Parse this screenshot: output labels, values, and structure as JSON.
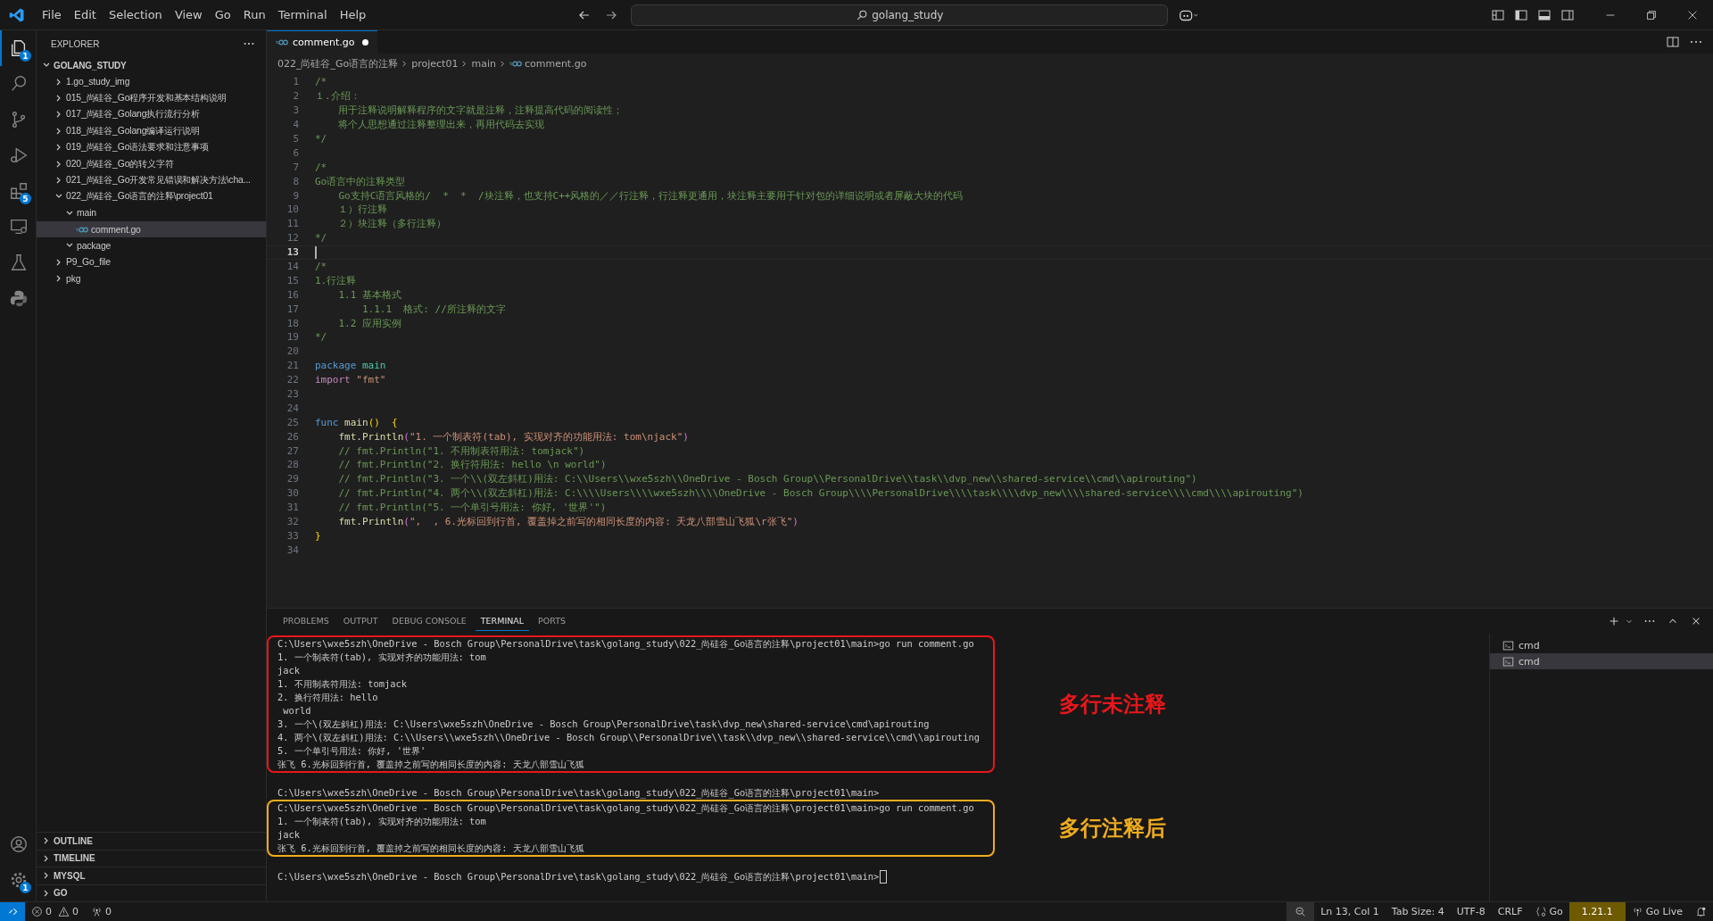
{
  "menu": [
    "File",
    "Edit",
    "Selection",
    "View",
    "Go",
    "Run",
    "Terminal",
    "Help"
  ],
  "command_center": "golang_study",
  "activity_bar": [
    {
      "kind": "explorer",
      "selected": true,
      "badge": "1"
    },
    {
      "kind": "search",
      "selected": false
    },
    {
      "kind": "source-control",
      "selected": false
    },
    {
      "kind": "run-debug",
      "selected": false
    },
    {
      "kind": "extensions",
      "selected": false,
      "badge": "5"
    },
    {
      "kind": "remote",
      "selected": false
    },
    {
      "kind": "testing",
      "selected": false
    },
    {
      "kind": "python",
      "selected": false
    }
  ],
  "activity_bottom": [
    {
      "kind": "account"
    },
    {
      "kind": "settings",
      "badge": "1"
    }
  ],
  "sidebar": {
    "title": "EXPLORER",
    "root": "GOLANG_STUDY",
    "tree": [
      {
        "kind": "folder",
        "label": "1.go_study_img",
        "expanded": false,
        "selected": false
      },
      {
        "kind": "folder",
        "label": "015_尚硅谷_Go程序开发和基本结构说明",
        "expanded": false,
        "selected": false
      },
      {
        "kind": "folder",
        "label": "017_尚硅谷_Golang执行流行分析",
        "expanded": false,
        "selected": false
      },
      {
        "kind": "folder",
        "label": "018_尚硅谷_Golang编译运行说明",
        "expanded": false,
        "selected": false
      },
      {
        "kind": "folder",
        "label": "019_尚硅谷_Go语法要求和注意事项",
        "expanded": false,
        "selected": false
      },
      {
        "kind": "folder",
        "label": "020_尚硅谷_Go的转义字符",
        "expanded": false,
        "selected": false
      },
      {
        "kind": "folder",
        "label": "021_尚硅谷_Go开发常见错误和解决方法\\cha...",
        "expanded": false,
        "selected": false
      },
      {
        "kind": "folder",
        "label": "022_尚硅谷_Go语言的注释\\project01",
        "expanded": true,
        "selected": false,
        "children": [
          {
            "kind": "folder",
            "label": "main",
            "expanded": true,
            "selected": false,
            "children": [
              {
                "kind": "file",
                "label": "comment.go",
                "selected": true
              }
            ]
          },
          {
            "kind": "folder",
            "label": "package",
            "expanded": true,
            "selected": false
          }
        ]
      },
      {
        "kind": "folder",
        "label": "P9_Go_file",
        "expanded": false,
        "selected": false
      },
      {
        "kind": "folder",
        "label": "pkg",
        "expanded": false,
        "selected": false
      }
    ],
    "sections": [
      "OUTLINE",
      "TIMELINE",
      "MYSQL",
      "GO"
    ]
  },
  "tab": {
    "label": "comment.go",
    "modified": true
  },
  "breadcrumb": [
    "022_尚硅谷_Go语言的注释",
    "project01",
    "main",
    "comment.go"
  ],
  "code": [
    {
      "n": "1",
      "current": false,
      "tokens": [
        {
          "kind": "comment",
          "t": "/*"
        }
      ]
    },
    {
      "n": "2",
      "current": false,
      "tokens": [
        {
          "kind": "comment",
          "t": "１.介绍："
        }
      ]
    },
    {
      "n": "3",
      "current": false,
      "tokens": [
        {
          "kind": "comment",
          "t": "    用于注释说明解释程序的文字就是注释，注释提高代码的阅读性；"
        }
      ]
    },
    {
      "n": "4",
      "current": false,
      "tokens": [
        {
          "kind": "comment",
          "t": "    将个人思想通过注释整理出来，再用代码去实现"
        }
      ]
    },
    {
      "n": "5",
      "current": false,
      "tokens": [
        {
          "kind": "comment",
          "t": "*/"
        }
      ]
    },
    {
      "n": "6",
      "current": false
    },
    {
      "n": "7",
      "current": false,
      "tokens": [
        {
          "kind": "comment",
          "t": "/*"
        }
      ]
    },
    {
      "n": "8",
      "current": false,
      "tokens": [
        {
          "kind": "comment",
          "t": "Go语言中的注释类型"
        }
      ]
    },
    {
      "n": "9",
      "current": false,
      "tokens": [
        {
          "kind": "comment",
          "t": "    Go支持C语言风格的/  *  *  /块注释，也支持C++风格的／／行注释，行注释更通用，块注释主要用于针对包的详细说明或者屏蔽大块的代码"
        }
      ]
    },
    {
      "n": "10",
      "current": false,
      "tokens": [
        {
          "kind": "comment",
          "t": "    １）行注释"
        }
      ]
    },
    {
      "n": "11",
      "current": false,
      "tokens": [
        {
          "kind": "comment",
          "t": "    ２）块注释（多行注释）"
        }
      ]
    },
    {
      "n": "12",
      "current": false,
      "tokens": [
        {
          "kind": "comment",
          "t": "*/"
        }
      ]
    },
    {
      "n": "13",
      "current": true
    },
    {
      "n": "14",
      "current": false,
      "tokens": [
        {
          "kind": "comment",
          "t": "/*"
        }
      ]
    },
    {
      "n": "15",
      "current": false,
      "tokens": [
        {
          "kind": "comment",
          "t": "1.行注释"
        }
      ]
    },
    {
      "n": "16",
      "current": false,
      "tokens": [
        {
          "kind": "comment",
          "t": "    1.1 基本格式"
        }
      ]
    },
    {
      "n": "17",
      "current": false,
      "tokens": [
        {
          "kind": "comment",
          "t": "        1.1.1  格式: //所注释的文字"
        }
      ]
    },
    {
      "n": "18",
      "current": false,
      "tokens": [
        {
          "kind": "comment",
          "t": "    1.2 应用实例"
        }
      ]
    },
    {
      "n": "19",
      "current": false,
      "tokens": [
        {
          "kind": "comment",
          "t": "*/"
        }
      ]
    },
    {
      "n": "20",
      "current": false
    },
    {
      "n": "21",
      "current": false,
      "tokens": [
        {
          "kind": "keyword",
          "t": "package"
        },
        {
          "kind": "type",
          "t": " main"
        }
      ]
    },
    {
      "n": "22",
      "current": false,
      "tokens": [
        {
          "kind": "control",
          "t": "import"
        },
        {
          "kind": "string",
          "t": " \"fmt\""
        }
      ]
    },
    {
      "n": "23",
      "current": false
    },
    {
      "n": "24",
      "current": false
    },
    {
      "n": "25",
      "current": false,
      "tokens": [
        {
          "kind": "keyword",
          "t": "func"
        },
        {
          "kind": "func",
          "t": " main"
        },
        {
          "kind": "brace",
          "t": "()"
        },
        {
          "kind": "brace",
          "t": "  {"
        }
      ]
    },
    {
      "n": "26",
      "current": false,
      "tokens": [
        {
          "kind": "func",
          "t": "    fmt.Println"
        },
        {
          "kind": "brace2",
          "t": "("
        },
        {
          "kind": "string",
          "t": "\"1. 一个制表符(tab), 实现对齐的功能用法: tom\\njack\""
        },
        {
          "kind": "brace2",
          "t": ")"
        }
      ]
    },
    {
      "n": "27",
      "current": false,
      "tokens": [
        {
          "kind": "comment",
          "t": "    // fmt.Println(\"1. 不用制表符用法: tomjack\")"
        }
      ]
    },
    {
      "n": "28",
      "current": false,
      "tokens": [
        {
          "kind": "comment",
          "t": "    // fmt.Println(\"2. 换行符用法: hello \\n world\")"
        }
      ]
    },
    {
      "n": "29",
      "current": false,
      "tokens": [
        {
          "kind": "comment",
          "t": "    // fmt.Println(\"3. 一个\\\\(双左斜杠)用法: C:\\\\Users\\\\wxe5szh\\\\OneDrive - Bosch Group\\\\PersonalDrive\\\\task\\\\dvp_new\\\\shared-service\\\\cmd\\\\apirouting\")"
        }
      ]
    },
    {
      "n": "30",
      "current": false,
      "tokens": [
        {
          "kind": "comment",
          "t": "    // fmt.Println(\"4. 两个\\\\(双左斜杠)用法: C:\\\\\\\\Users\\\\\\\\wxe5szh\\\\\\\\OneDrive - Bosch Group\\\\\\\\PersonalDrive\\\\\\\\task\\\\\\\\dvp_new\\\\\\\\shared-service\\\\\\\\cmd\\\\\\\\apirouting\")"
        }
      ]
    },
    {
      "n": "31",
      "current": false,
      "tokens": [
        {
          "kind": "comment",
          "t": "    // fmt.Println(\"5. 一个单引号用法: 你好, '世界'\")"
        }
      ]
    },
    {
      "n": "32",
      "current": false,
      "tokens": [
        {
          "kind": "func",
          "t": "    fmt.Println"
        },
        {
          "kind": "brace2",
          "t": "("
        },
        {
          "kind": "string",
          "t": "\",  , 6.光标回到行首, 覆盖掉之前写的相同长度的内容: 天龙八部雪山飞狐\\r张飞\""
        },
        {
          "kind": "brace2",
          "t": ")"
        }
      ]
    },
    {
      "n": "33",
      "current": false,
      "tokens": [
        {
          "kind": "brace",
          "t": "}"
        }
      ]
    },
    {
      "n": "34",
      "current": false
    }
  ],
  "panel": {
    "tabs": [
      {
        "label": "PROBLEMS",
        "selected": false
      },
      {
        "label": "OUTPUT",
        "selected": false
      },
      {
        "label": "DEBUG CONSOLE",
        "selected": false
      },
      {
        "label": "TERMINAL",
        "selected": true
      },
      {
        "label": "PORTS",
        "selected": false
      }
    ],
    "terminal_blocks": [
      {
        "kind": "framed",
        "color": "#e8171b",
        "note": "多行未注释",
        "lines": [
          "C:\\Users\\wxe5szh\\OneDrive - Bosch Group\\PersonalDrive\\task\\golang_study\\022_尚硅谷_Go语言的注释\\project01\\main>go run comment.go",
          "1. 一个制表符(tab), 实现对齐的功能用法: tom",
          "jack",
          "1. 不用制表符用法: tomjack",
          "2. 换行符用法: hello",
          " world",
          "3. 一个\\(双左斜杠)用法: C:\\Users\\wxe5szh\\OneDrive - Bosch Group\\PersonalDrive\\task\\dvp_new\\shared-service\\cmd\\apirouting",
          "4. 两个\\(双左斜杠)用法: C:\\\\Users\\\\wxe5szh\\\\OneDrive - Bosch Group\\\\PersonalDrive\\\\task\\\\dvp_new\\\\shared-service\\\\cmd\\\\apirouting",
          "5. 一个单引号用法: 你好, '世界'",
          "张飞 6.光标回到行首, 覆盖掉之前写的相同长度的内容: 天龙八部雪山飞狐"
        ]
      },
      {
        "kind": "plain",
        "cursor": false,
        "lines": [
          "C:\\Users\\wxe5szh\\OneDrive - Bosch Group\\PersonalDrive\\task\\golang_study\\022_尚硅谷_Go语言的注释\\project01\\main>"
        ]
      },
      {
        "kind": "framed",
        "color": "#f0ad1c",
        "note": "多行注释后",
        "lines": [
          "C:\\Users\\wxe5szh\\OneDrive - Bosch Group\\PersonalDrive\\task\\golang_study\\022_尚硅谷_Go语言的注释\\project01\\main>go run comment.go",
          "1. 一个制表符(tab), 实现对齐的功能用法: tom",
          "jack",
          "张飞 6.光标回到行首, 覆盖掉之前写的相同长度的内容: 天龙八部雪山飞狐"
        ]
      },
      {
        "kind": "plain",
        "cursor": true,
        "lines": [
          "C:\\Users\\wxe5szh\\OneDrive - Bosch Group\\PersonalDrive\\task\\golang_study\\022_尚硅谷_Go语言的注释\\project01\\main>"
        ]
      }
    ],
    "terminals": [
      {
        "label": "cmd",
        "selected": false
      },
      {
        "label": "cmd",
        "selected": true
      }
    ]
  },
  "status_left": [
    {
      "kind": "remote"
    },
    {
      "kind": "errors",
      "text": "0"
    },
    {
      "kind": "warnings",
      "text": "0"
    },
    {
      "kind": "ports",
      "text": "0"
    }
  ],
  "status_right": [
    {
      "kind": "zoom"
    },
    {
      "kind": "text",
      "text": "Ln 13, Col 1"
    },
    {
      "kind": "text",
      "text": "Tab Size: 4"
    },
    {
      "kind": "text",
      "text": "UTF-8"
    },
    {
      "kind": "text",
      "text": "CRLF"
    },
    {
      "kind": "language",
      "text": "Go"
    },
    {
      "kind": "version",
      "text": "1.21.1"
    },
    {
      "kind": "live",
      "text": "Go Live"
    },
    {
      "kind": "bell"
    }
  ]
}
